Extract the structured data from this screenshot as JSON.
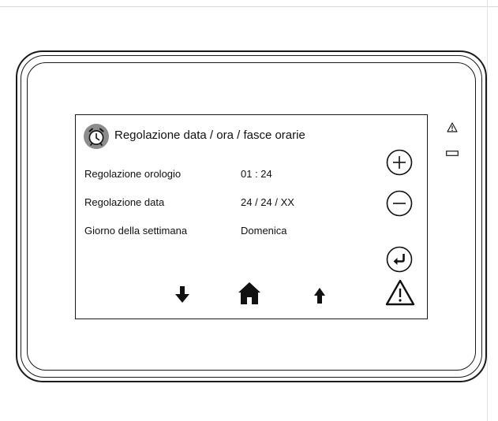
{
  "screen": {
    "title": "Regolazione data / ora / fasce orarie",
    "rows": [
      {
        "label": "Regolazione orologio",
        "value": "01  :  24"
      },
      {
        "label": "Regolazione data",
        "value": "24  /  24  /  XX"
      },
      {
        "label": "Giorno della settimana",
        "value": "Domenica"
      }
    ]
  },
  "icons": {
    "title": "alarm-clock-icon",
    "plus": "plus-circle-icon",
    "minus": "minus-circle-icon",
    "enter": "enter-return-icon",
    "down": "arrow-down-icon",
    "home": "home-icon",
    "up": "arrow-up-icon",
    "alarm": "warning-triangle-icon",
    "device_alarm_led": "warning-triangle-icon",
    "device_status_led": "status-led-icon"
  },
  "colors": {
    "icon_badge": "#8c8c8c",
    "line": "#1a1a1a"
  }
}
